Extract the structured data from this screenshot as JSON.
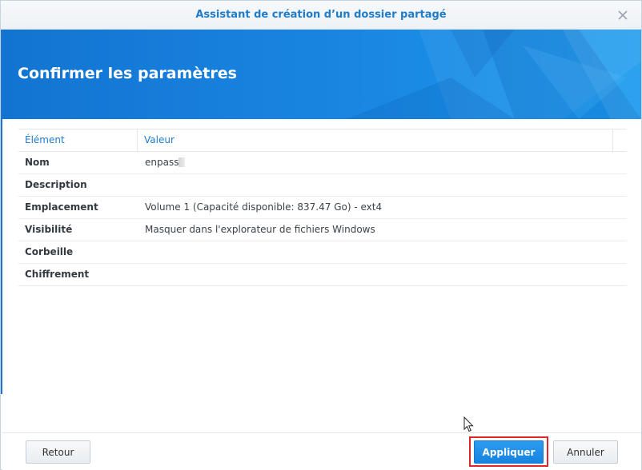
{
  "window": {
    "title": "Assistant de création d’un dossier partagé"
  },
  "banner": {
    "heading": "Confirmer les paramètres"
  },
  "table": {
    "headers": {
      "key": "Élément",
      "value": "Valeur"
    },
    "rows": [
      {
        "key": "Nom",
        "value": "enpass"
      },
      {
        "key": "Description",
        "value": ""
      },
      {
        "key": "Emplacement",
        "value": "Volume 1 (Capacité disponible: 837.47 Go) - ext4"
      },
      {
        "key": "Visibilité",
        "value": "Masquer dans l'explorateur de fichiers Windows"
      },
      {
        "key": "Corbeille",
        "value": ""
      },
      {
        "key": "Chiffrement",
        "value": ""
      }
    ]
  },
  "footer": {
    "back_label": "Retour",
    "apply_label": "Appliquer",
    "cancel_label": "Annuler"
  },
  "colors": {
    "accent": "#1f7cc9",
    "banner": "#1a86e2",
    "highlight": "#e0262b"
  },
  "icons": {
    "close": "close-icon",
    "cursor": "mouse-pointer-icon"
  }
}
